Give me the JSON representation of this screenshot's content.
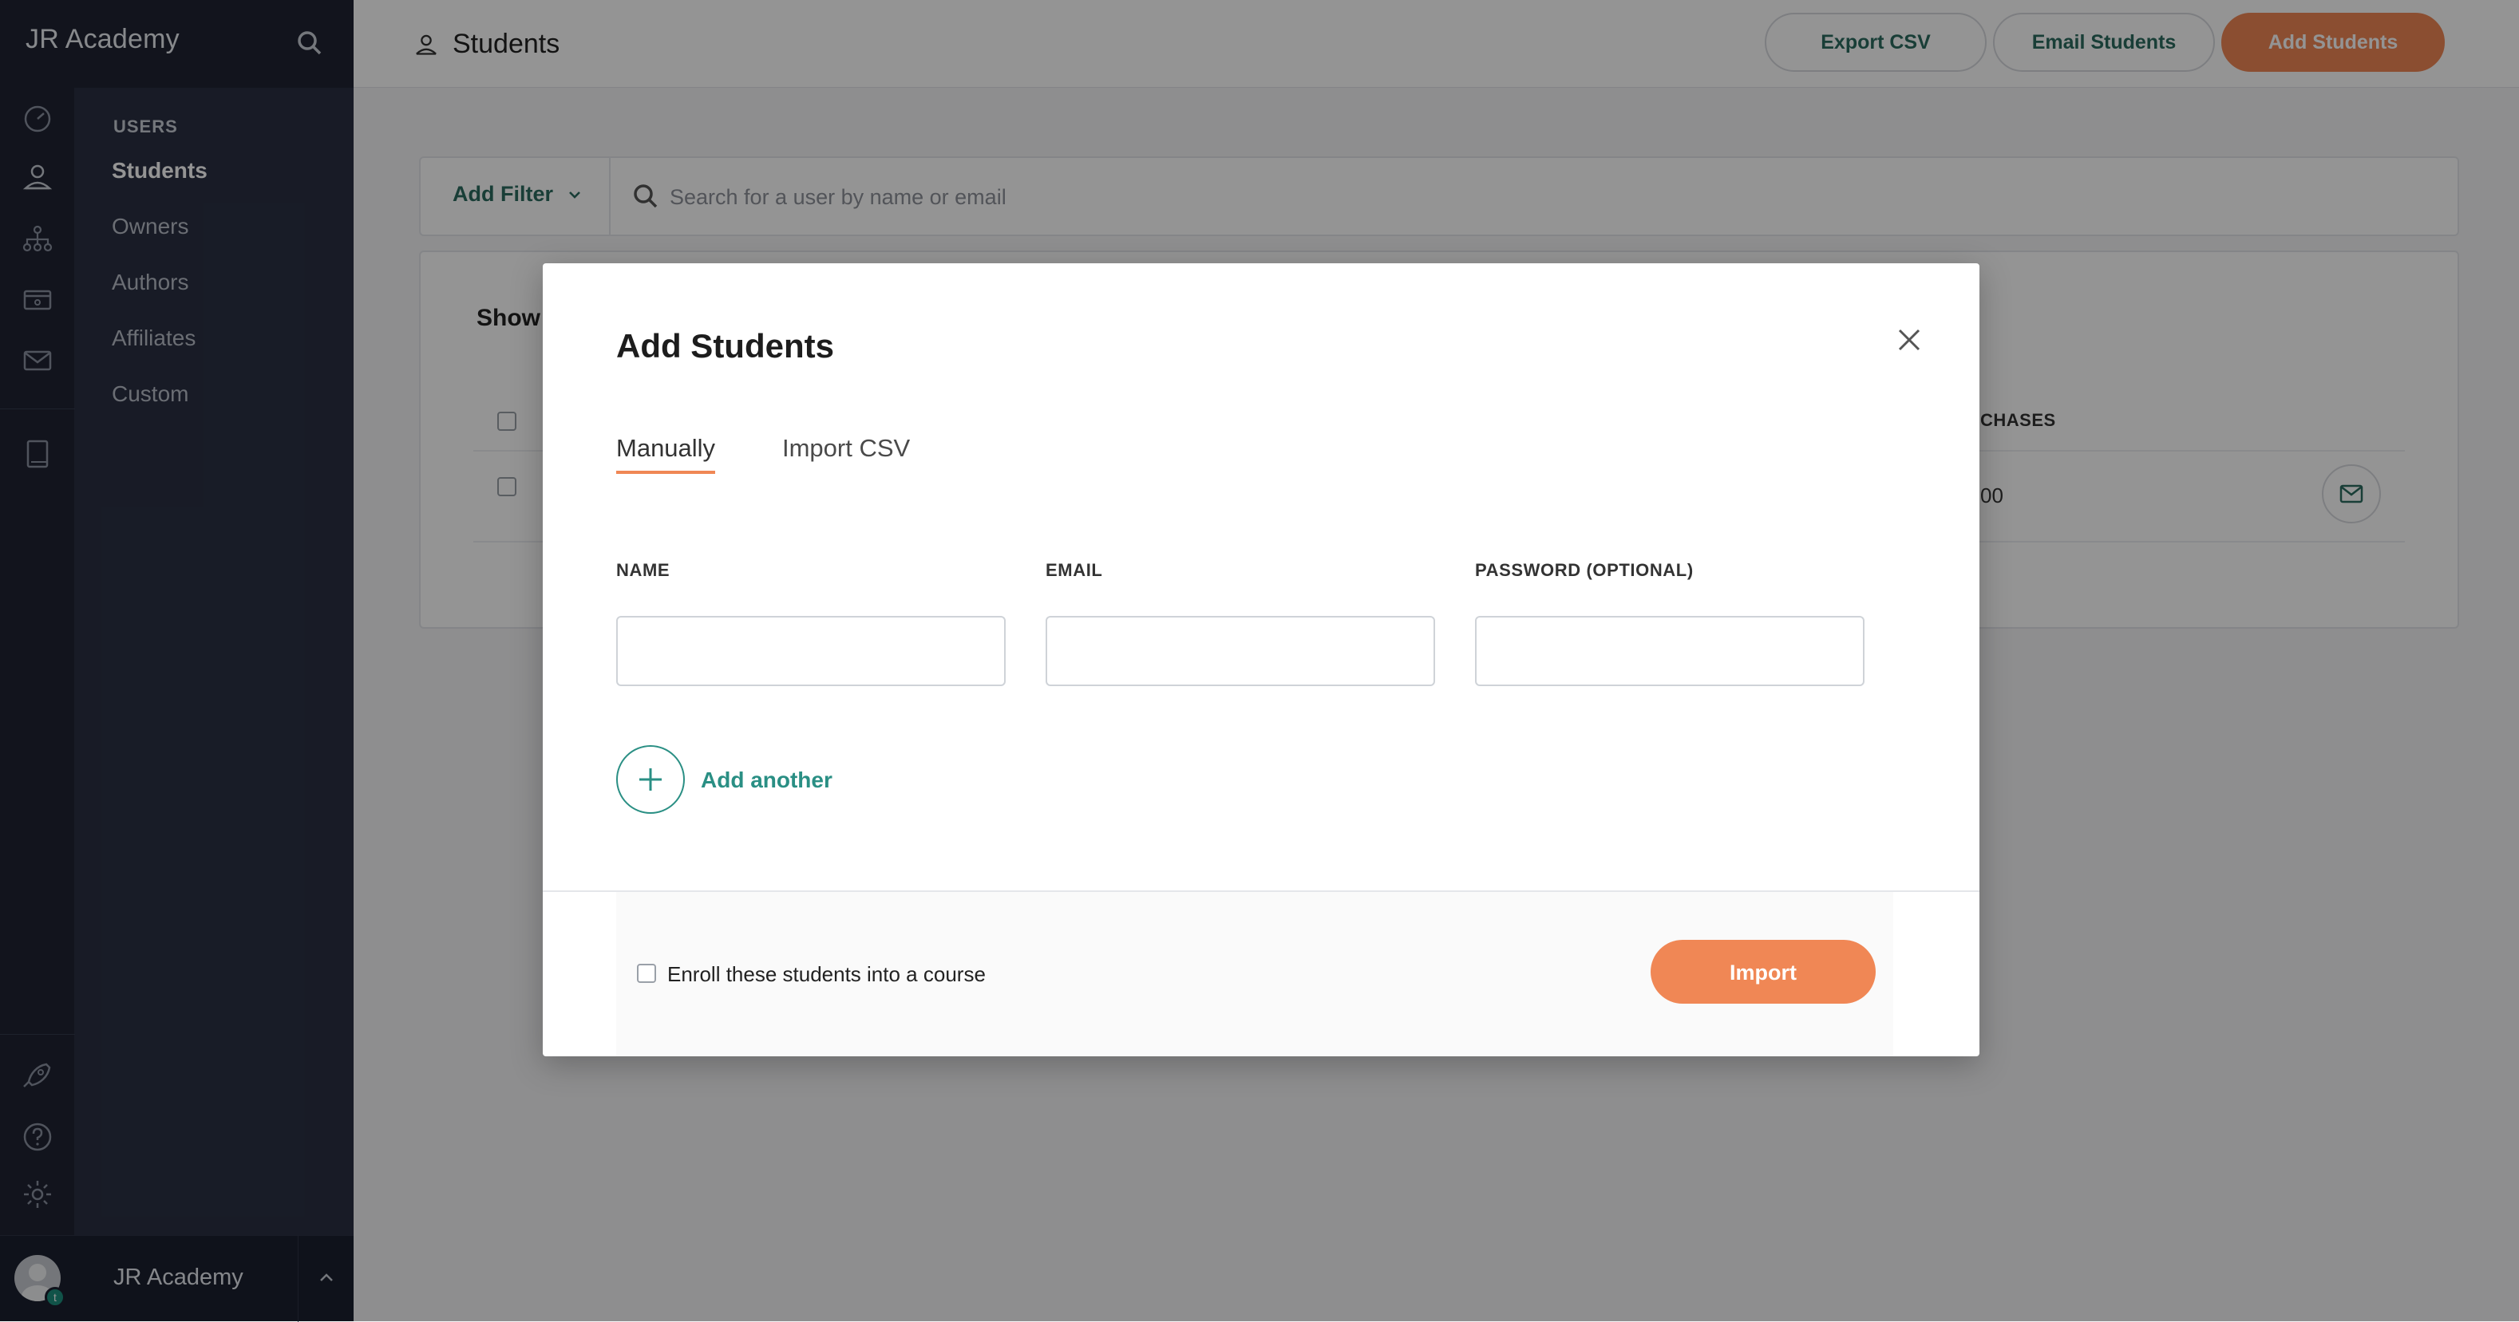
{
  "app": {
    "name": "JR Academy"
  },
  "sidebar": {
    "section_heading": "USERS",
    "items": [
      {
        "label": "Students",
        "active": true
      },
      {
        "label": "Owners"
      },
      {
        "label": "Authors"
      },
      {
        "label": "Affiliates"
      },
      {
        "label": "Custom"
      }
    ],
    "rail_icons": [
      "dashboard-icon",
      "users-icon",
      "sitemap-icon",
      "sales-icon",
      "mail-icon",
      "book-icon",
      "rocket-icon",
      "help-icon",
      "settings-icon"
    ],
    "footer": {
      "name": "JR Academy",
      "avatar_badge": "t"
    }
  },
  "header": {
    "title": "Students",
    "buttons": {
      "export": "Export CSV",
      "email": "Email Students",
      "add": "Add Students"
    }
  },
  "filter": {
    "add_filter_label": "Add Filter",
    "search_placeholder": "Search for a user by name or email"
  },
  "table": {
    "show_label": "Show",
    "column_purchases_partial": "CHASES",
    "row_value_partial": "00"
  },
  "modal": {
    "title": "Add Students",
    "tabs": [
      {
        "label": "Manually",
        "active": true
      },
      {
        "label": "Import CSV"
      }
    ],
    "fields": {
      "name_label": "NAME",
      "email_label": "EMAIL",
      "password_label": "PASSWORD (OPTIONAL)",
      "name_value": "",
      "email_value": "",
      "password_value": ""
    },
    "add_another_label": "Add another",
    "enroll_label": "Enroll these students into a course",
    "enroll_checked": false,
    "import_label": "Import"
  },
  "colors": {
    "accent_orange": "#f08755",
    "accent_teal": "#2a8f84",
    "sidebar_bg": "#1f2433"
  }
}
